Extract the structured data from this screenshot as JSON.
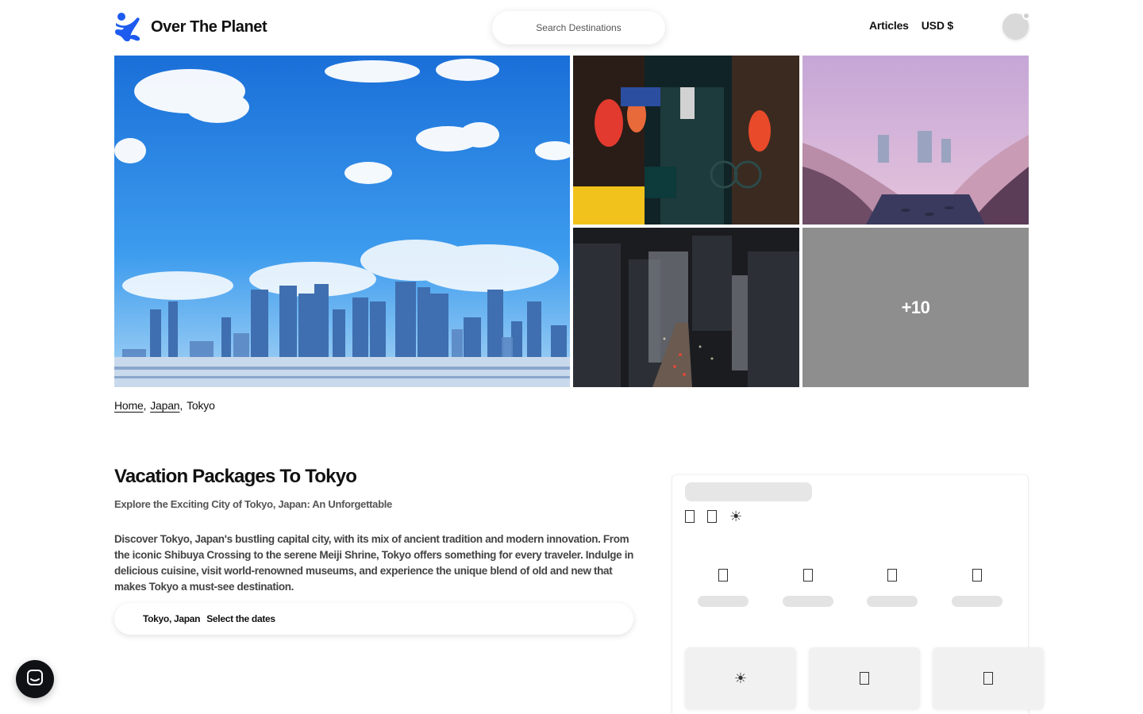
{
  "header": {
    "brand": "Over The Planet",
    "search_placeholder": "Search Destinations",
    "nav": {
      "articles": "Articles",
      "currency": "USD $"
    }
  },
  "gallery": {
    "more_count": "+10",
    "images": [
      "tokyo-skyline",
      "izakaya-alley",
      "cherry-blossom-river",
      "night-city-aerial"
    ]
  },
  "breadcrumb": {
    "home": "Home",
    "country": "Japan",
    "city": "Tokyo",
    "separator": ","
  },
  "content": {
    "title": "Vacation Packages To Tokyo",
    "subtitle": "Explore the Exciting City of Tokyo, Japan: An Unforgettable",
    "description": "Discover Tokyo, Japan's bustling capital city, with its mix of ancient tradition and modern innovation. From the iconic Shibuya Crossing to the serene Meiji Shrine, Tokyo offers something for every traveler. Indulge in delicious cuisine, visit world-renowned museums, and experience the unique blend of old and new that makes Tokyo a must-see destination.",
    "trip_location": "Tokyo, Japan",
    "trip_dates": "Select the dates"
  },
  "side_panel": {
    "state": "loading",
    "icons": [
      "box-icon",
      "box-icon",
      "sun-icon"
    ],
    "columns": 4,
    "cards": [
      "sun-icon",
      "box-icon",
      "box-icon"
    ]
  },
  "colors": {
    "text": "#111111",
    "muted": "#555555",
    "skeleton": "#e4e4e4",
    "brand": "#1d5bf0"
  }
}
